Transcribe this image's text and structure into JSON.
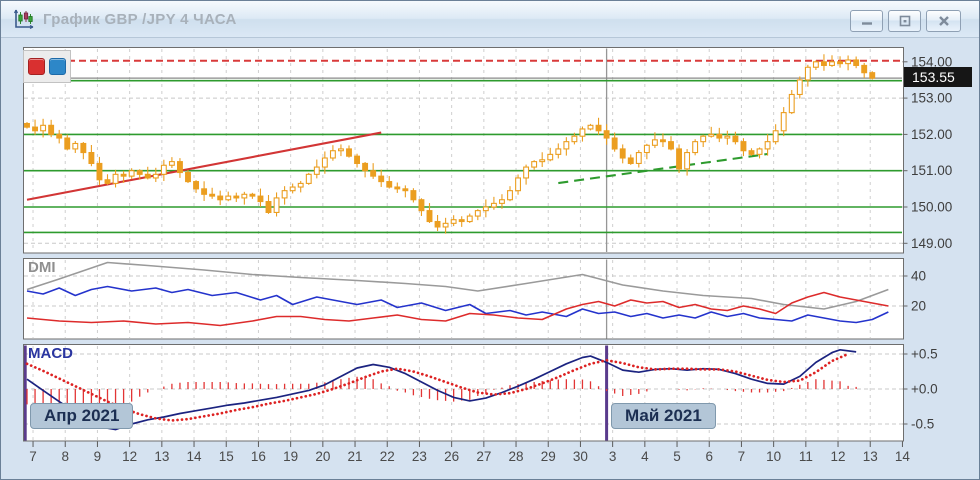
{
  "window": {
    "title": "График GBP /JPY 4 ЧАСА"
  },
  "legend": {
    "buttons": [
      {
        "name": "red-series-button",
        "color": "#D93030",
        "border": "#A32121"
      },
      {
        "name": "blue-series-button",
        "color": "#2D87C8",
        "border": "#1D6AA8"
      }
    ]
  },
  "chart_data": [
    {
      "id": "price",
      "type": "candlestick",
      "title": "GBP/JPY 4 часа",
      "candle_color": "#EB9E20",
      "current_price": "153.55",
      "current_price_line": 153.55,
      "y_tick_labels": [
        "154.00",
        "153.00",
        "152.00",
        "151.00",
        "150.00",
        "149.00"
      ],
      "grid_dashed_prices": [
        153.0,
        149.0
      ],
      "green_levels": [
        153.48,
        152.0,
        151.0,
        150.0,
        149.3
      ],
      "green_level_color": "#2E9B2E",
      "red_dashed_level": 154.03,
      "red_level_color": "#D93A3A",
      "first_open": 152.3,
      "closes": [
        152.2,
        152.1,
        152.25,
        152.0,
        151.9,
        151.6,
        151.75,
        151.5,
        151.2,
        150.75,
        150.65,
        150.9,
        150.85,
        151.0,
        150.9,
        150.8,
        150.9,
        151.15,
        151.25,
        150.95,
        150.7,
        150.5,
        150.35,
        150.3,
        150.2,
        150.3,
        150.25,
        150.35,
        150.3,
        150.15,
        149.85,
        150.25,
        150.45,
        150.55,
        150.65,
        150.9,
        151.1,
        151.35,
        151.55,
        151.6,
        151.4,
        151.2,
        151.0,
        150.85,
        150.7,
        150.55,
        150.5,
        150.45,
        150.2,
        149.9,
        149.6,
        149.45,
        149.55,
        149.65,
        149.6,
        149.75,
        149.9,
        150.0,
        150.1,
        150.2,
        150.45,
        150.8,
        151.1,
        151.25,
        151.3,
        151.45,
        151.6,
        151.8,
        151.95,
        152.15,
        152.25,
        152.1,
        151.9,
        151.6,
        151.35,
        151.2,
        151.5,
        151.7,
        151.85,
        151.8,
        151.6,
        151.05,
        151.5,
        151.8,
        151.95,
        152.0,
        151.9,
        151.95,
        151.8,
        151.55,
        151.45,
        151.6,
        151.8,
        152.1,
        152.6,
        153.1,
        153.5,
        153.85,
        154.0,
        153.9,
        154.0,
        153.95,
        154.05,
        153.9,
        153.7,
        153.55
      ],
      "trendlines": [
        {
          "name": "red-uptrend-line",
          "color": "#D23535",
          "dash": false,
          "from": [
            0,
            150.2
          ],
          "to": [
            44,
            152.05
          ]
        },
        {
          "name": "green-support-line",
          "color": "#2E9B2E",
          "dash": true,
          "from": [
            66,
            150.66
          ],
          "to": [
            92,
            151.46
          ]
        }
      ],
      "month_separator_bar": 72,
      "x_labels": [
        "7",
        "8",
        "9",
        "12",
        "13",
        "14",
        "15",
        "16",
        "19",
        "20",
        "21",
        "22",
        "23",
        "26",
        "27",
        "28",
        "29",
        "30",
        "3",
        "4",
        "5",
        "6",
        "7",
        "10",
        "11",
        "12",
        "13",
        "14"
      ]
    },
    {
      "id": "dmi",
      "type": "line",
      "title": "DMI",
      "y_tick_labels": [
        "40",
        "20"
      ],
      "y_tick_values": [
        40,
        20
      ],
      "month_separator_bar": 72,
      "series": [
        {
          "name": "adx-line",
          "color": "#9A9A9A",
          "points": [
            [
              0,
              31
            ],
            [
              4,
              38
            ],
            [
              10,
              49
            ],
            [
              15,
              47
            ],
            [
              22,
              44
            ],
            [
              28,
              41
            ],
            [
              34,
              39
            ],
            [
              41,
              37
            ],
            [
              47,
              35
            ],
            [
              52,
              33
            ],
            [
              56,
              30
            ],
            [
              62,
              35
            ],
            [
              69,
              41
            ],
            [
              74,
              34
            ],
            [
              79,
              30
            ],
            [
              84,
              27
            ],
            [
              90,
              25
            ],
            [
              94,
              21
            ],
            [
              99,
              18
            ],
            [
              103,
              23
            ],
            [
              107,
              31
            ]
          ]
        },
        {
          "name": "plus-di-line",
          "color": "#2433CC",
          "points": [
            [
              0,
              30
            ],
            [
              2,
              28
            ],
            [
              4,
              32
            ],
            [
              6,
              27
            ],
            [
              8,
              31
            ],
            [
              10,
              33
            ],
            [
              13,
              30
            ],
            [
              16,
              32
            ],
            [
              18,
              29
            ],
            [
              20,
              31
            ],
            [
              23,
              27
            ],
            [
              26,
              29
            ],
            [
              29,
              24
            ],
            [
              31,
              27
            ],
            [
              33,
              21
            ],
            [
              36,
              26
            ],
            [
              39,
              23
            ],
            [
              41,
              21
            ],
            [
              44,
              24
            ],
            [
              46,
              19
            ],
            [
              49,
              22
            ],
            [
              52,
              17
            ],
            [
              55,
              21
            ],
            [
              57,
              15
            ],
            [
              60,
              17
            ],
            [
              62,
              14
            ],
            [
              64,
              16
            ],
            [
              67,
              13
            ],
            [
              69,
              18
            ],
            [
              71,
              15
            ],
            [
              73,
              16
            ],
            [
              75,
              13
            ],
            [
              77,
              15
            ],
            [
              79,
              12
            ],
            [
              81,
              14
            ],
            [
              83,
              12
            ],
            [
              85,
              16
            ],
            [
              87,
              13
            ],
            [
              89,
              15
            ],
            [
              91,
              12
            ],
            [
              93,
              11
            ],
            [
              95,
              10
            ],
            [
              97,
              14
            ],
            [
              99,
              12
            ],
            [
              101,
              10
            ],
            [
              103,
              9
            ],
            [
              105,
              11
            ],
            [
              107,
              16
            ]
          ]
        },
        {
          "name": "minus-di-line",
          "color": "#DD2B2B",
          "points": [
            [
              0,
              12
            ],
            [
              4,
              10
            ],
            [
              8,
              9
            ],
            [
              12,
              10
            ],
            [
              16,
              8
            ],
            [
              20,
              9
            ],
            [
              24,
              7
            ],
            [
              28,
              10
            ],
            [
              31,
              13
            ],
            [
              34,
              13
            ],
            [
              37,
              11
            ],
            [
              40,
              10
            ],
            [
              43,
              12
            ],
            [
              46,
              14
            ],
            [
              49,
              11
            ],
            [
              52,
              10
            ],
            [
              55,
              15
            ],
            [
              58,
              14
            ],
            [
              61,
              12
            ],
            [
              64,
              11
            ],
            [
              67,
              18
            ],
            [
              69,
              21
            ],
            [
              71,
              23
            ],
            [
              73,
              20
            ],
            [
              75,
              24
            ],
            [
              77,
              22
            ],
            [
              79,
              23
            ],
            [
              81,
              19
            ],
            [
              83,
              21
            ],
            [
              85,
              18
            ],
            [
              87,
              17
            ],
            [
              89,
              20
            ],
            [
              91,
              18
            ],
            [
              93,
              15
            ],
            [
              95,
              22
            ],
            [
              97,
              26
            ],
            [
              99,
              29
            ],
            [
              101,
              26
            ],
            [
              103,
              24
            ],
            [
              105,
              22
            ],
            [
              107,
              20
            ]
          ]
        }
      ]
    },
    {
      "id": "macd",
      "type": "line",
      "title": "MACD",
      "y_tick_labels": [
        "+0.5",
        "+0.0",
        "-0.5"
      ],
      "y_tick_values": [
        0.5,
        0.0,
        -0.5
      ],
      "month_separator_bar": 72,
      "histogram": {
        "color": "#E23535"
      },
      "months": [
        {
          "label": "Апр 2021",
          "bar": 0
        },
        {
          "label": "Май 2021",
          "bar": 72
        }
      ],
      "series": [
        {
          "name": "macd-line",
          "color": "#1B2380",
          "dotted": false,
          "points": [
            [
              0,
              0.14
            ],
            [
              2,
              -0.02
            ],
            [
              4,
              -0.18
            ],
            [
              6,
              -0.33
            ],
            [
              8,
              -0.46
            ],
            [
              10,
              -0.56
            ],
            [
              11,
              -0.58
            ],
            [
              13,
              -0.5
            ],
            [
              15,
              -0.44
            ],
            [
              17,
              -0.4
            ],
            [
              19,
              -0.35
            ],
            [
              21,
              -0.31
            ],
            [
              23,
              -0.27
            ],
            [
              25,
              -0.23
            ],
            [
              27,
              -0.2
            ],
            [
              29,
              -0.16
            ],
            [
              31,
              -0.12
            ],
            [
              33,
              -0.07
            ],
            [
              35,
              -0.02
            ],
            [
              37,
              0.06
            ],
            [
              39,
              0.18
            ],
            [
              41,
              0.3
            ],
            [
              43,
              0.35
            ],
            [
              45,
              0.31
            ],
            [
              47,
              0.22
            ],
            [
              49,
              0.1
            ],
            [
              51,
              -0.02
            ],
            [
              53,
              -0.12
            ],
            [
              55,
              -0.17
            ],
            [
              57,
              -0.13
            ],
            [
              59,
              -0.05
            ],
            [
              61,
              0.04
            ],
            [
              63,
              0.14
            ],
            [
              65,
              0.25
            ],
            [
              67,
              0.36
            ],
            [
              69,
              0.45
            ],
            [
              70,
              0.47
            ],
            [
              72,
              0.38
            ],
            [
              74,
              0.27
            ],
            [
              76,
              0.24
            ],
            [
              78,
              0.28
            ],
            [
              80,
              0.29
            ],
            [
              82,
              0.27
            ],
            [
              84,
              0.29
            ],
            [
              86,
              0.28
            ],
            [
              88,
              0.22
            ],
            [
              90,
              0.14
            ],
            [
              92,
              0.08
            ],
            [
              94,
              0.07
            ],
            [
              96,
              0.18
            ],
            [
              98,
              0.38
            ],
            [
              100,
              0.52
            ],
            [
              101,
              0.56
            ],
            [
              103,
              0.53
            ]
          ]
        },
        {
          "name": "signal-line",
          "color": "#DD2222",
          "dotted": true,
          "points": [
            [
              0,
              0.36
            ],
            [
              2,
              0.26
            ],
            [
              4,
              0.15
            ],
            [
              6,
              0.04
            ],
            [
              8,
              -0.07
            ],
            [
              10,
              -0.18
            ],
            [
              12,
              -0.28
            ],
            [
              14,
              -0.36
            ],
            [
              16,
              -0.42
            ],
            [
              18,
              -0.45
            ],
            [
              20,
              -0.43
            ],
            [
              22,
              -0.39
            ],
            [
              24,
              -0.35
            ],
            [
              26,
              -0.3
            ],
            [
              28,
              -0.26
            ],
            [
              30,
              -0.21
            ],
            [
              32,
              -0.17
            ],
            [
              34,
              -0.12
            ],
            [
              36,
              -0.07
            ],
            [
              38,
              0.0
            ],
            [
              40,
              0.08
            ],
            [
              42,
              0.17
            ],
            [
              44,
              0.25
            ],
            [
              46,
              0.29
            ],
            [
              48,
              0.25
            ],
            [
              50,
              0.18
            ],
            [
              52,
              0.1
            ],
            [
              54,
              0.02
            ],
            [
              56,
              -0.05
            ],
            [
              58,
              -0.08
            ],
            [
              60,
              -0.06
            ],
            [
              62,
              0.0
            ],
            [
              64,
              0.08
            ],
            [
              66,
              0.17
            ],
            [
              68,
              0.27
            ],
            [
              70,
              0.36
            ],
            [
              72,
              0.41
            ],
            [
              74,
              0.37
            ],
            [
              76,
              0.31
            ],
            [
              78,
              0.28
            ],
            [
              80,
              0.29
            ],
            [
              82,
              0.29
            ],
            [
              84,
              0.28
            ],
            [
              86,
              0.28
            ],
            [
              88,
              0.25
            ],
            [
              90,
              0.19
            ],
            [
              92,
              0.13
            ],
            [
              94,
              0.1
            ],
            [
              96,
              0.12
            ],
            [
              98,
              0.24
            ],
            [
              100,
              0.4
            ],
            [
              102,
              0.5
            ]
          ]
        }
      ]
    }
  ]
}
